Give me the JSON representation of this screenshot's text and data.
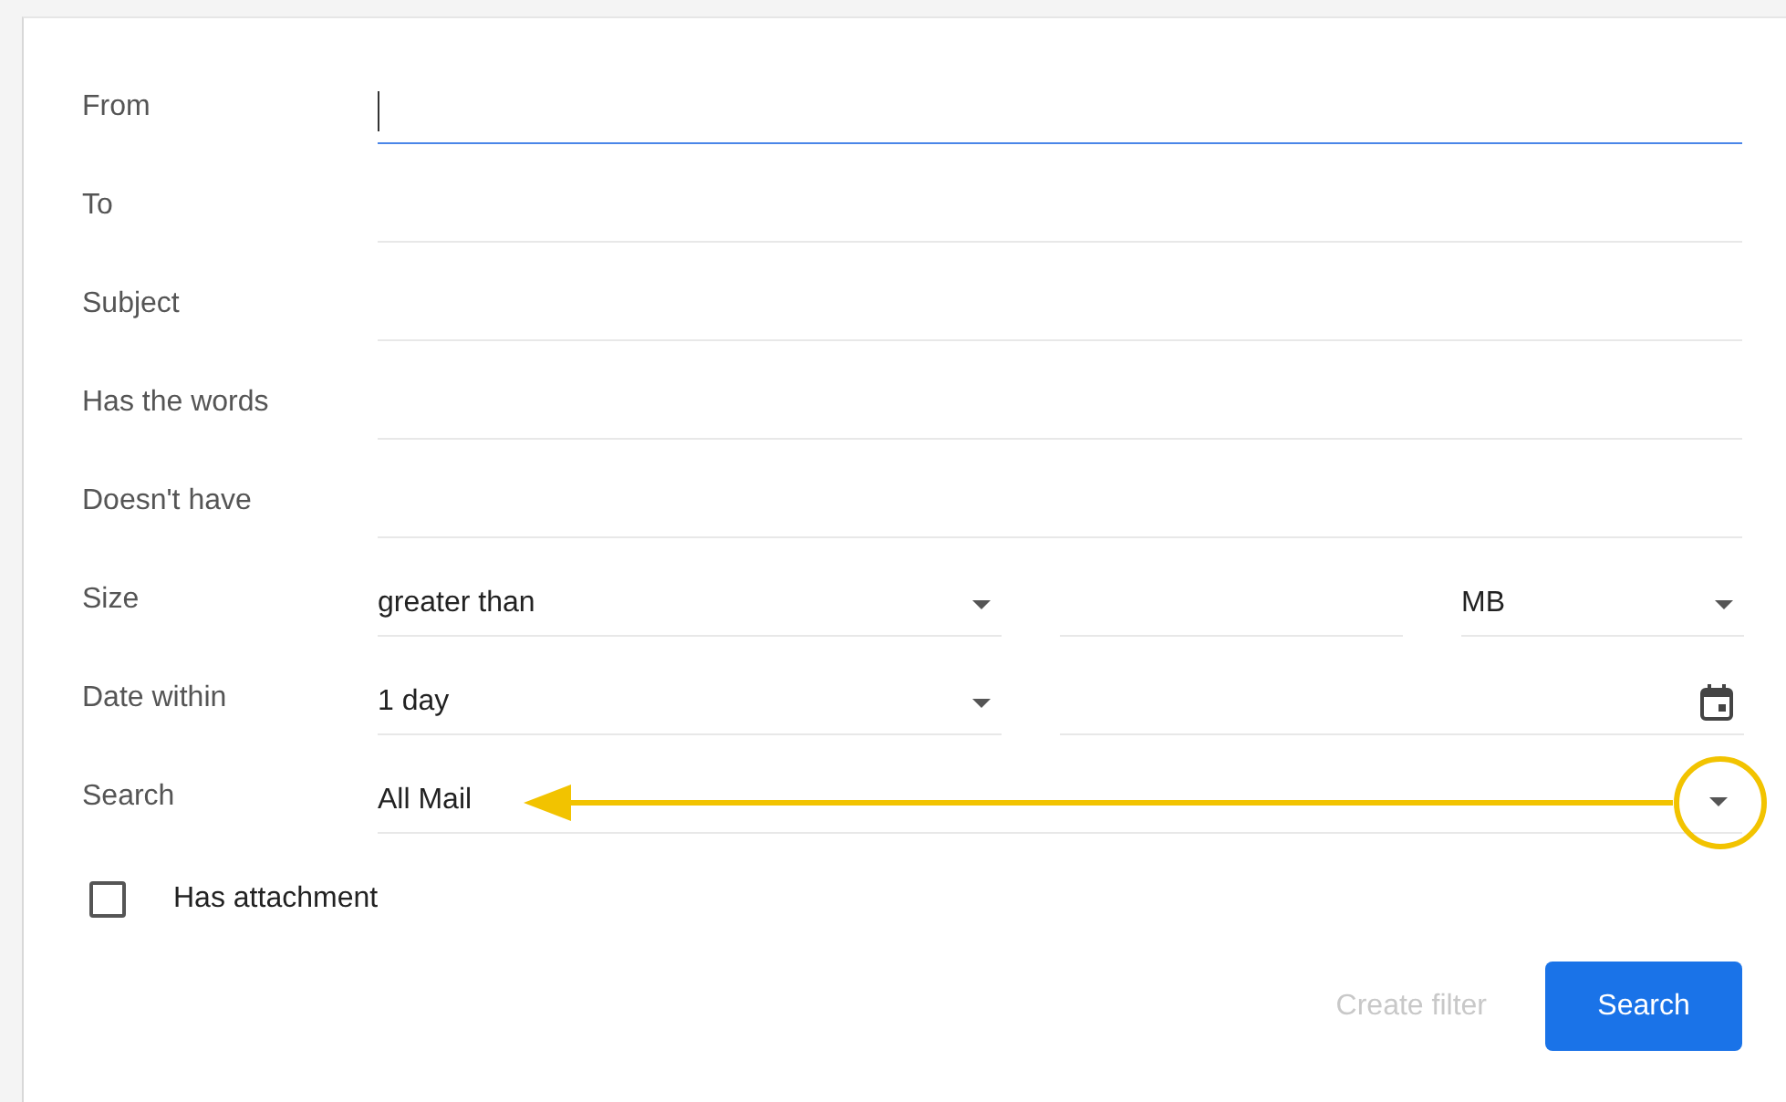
{
  "text_fields": [
    {
      "label": "From",
      "focused": true
    },
    {
      "label": "To",
      "focused": false
    },
    {
      "label": "Subject",
      "focused": false
    },
    {
      "label": "Has the words",
      "focused": false
    },
    {
      "label": "Doesn't have",
      "focused": false
    }
  ],
  "size": {
    "label": "Size",
    "operator": "greater than",
    "unit": "MB"
  },
  "date_within": {
    "label": "Date within",
    "range": "1 day"
  },
  "search_in": {
    "label": "Search",
    "value": "All Mail",
    "highlighted": true
  },
  "attachment": {
    "label": "Has attachment",
    "checked": false
  },
  "buttons": [
    {
      "label": "Create filter",
      "disabled": true,
      "primary": false
    },
    {
      "label": "Search",
      "disabled": false,
      "primary": true
    }
  ]
}
